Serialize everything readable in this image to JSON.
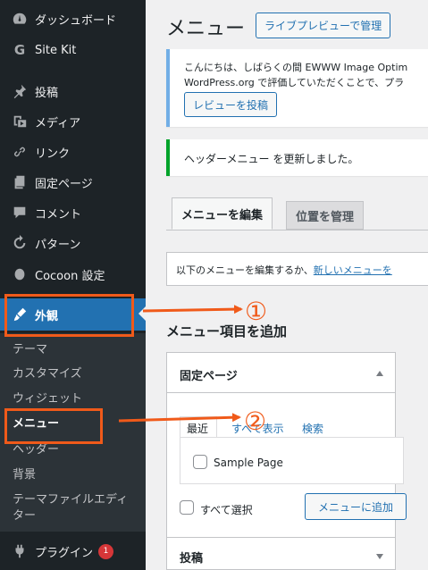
{
  "sidebar": {
    "items": [
      {
        "label": "ダッシュボード",
        "icon": "dashboard-icon"
      },
      {
        "label": "Site Kit",
        "icon": "google-g-icon"
      },
      {
        "label": "投稿",
        "icon": "pin-icon"
      },
      {
        "label": "メディア",
        "icon": "media-icon"
      },
      {
        "label": "リンク",
        "icon": "link-icon"
      },
      {
        "label": "固定ページ",
        "icon": "pages-icon"
      },
      {
        "label": "コメント",
        "icon": "comment-icon"
      },
      {
        "label": "パターン",
        "icon": "refresh-icon"
      },
      {
        "label": "Cocoon 設定",
        "icon": "circle-icon"
      },
      {
        "label": "外観",
        "icon": "brush-icon"
      }
    ],
    "submenu": [
      "テーマ",
      "カスタマイズ",
      "ウィジェット",
      "メニュー",
      "ヘッダー",
      "背景",
      "テーマファイルエディ",
      "ター"
    ],
    "plugins": {
      "label": "プラグイン",
      "badge": "1",
      "icon": "plugin-icon"
    }
  },
  "header": {
    "title": "メニュー",
    "live_preview_button": "ライブプレビューで管理"
  },
  "notices": {
    "info_line1": "こんにちは、しばらくの間 EWWW Image Optim",
    "info_line2": "WordPress.org で評価していただくことで、プラ",
    "review_button": "レビューを投稿",
    "success": "ヘッダーメニュー を更新しました。"
  },
  "tabs": {
    "edit": "メニューを編集",
    "locations": "位置を管理"
  },
  "manage_bar": {
    "text": "以下のメニューを編集するか、",
    "link": "新しいメニューを"
  },
  "add_items": {
    "title": "メニュー項目を追加",
    "pages_panel": "固定ページ",
    "inner_tabs": [
      "最近",
      "すべて表示",
      "検索"
    ],
    "item": "Sample Page",
    "select_all": "すべて選択",
    "add_button": "メニューに追加",
    "posts_panel": "投稿"
  },
  "annotations": {
    "mark1": "①",
    "mark2": "②",
    "color": "#f05a1a"
  },
  "colors": {
    "sidebar_bg": "#1d2327",
    "active": "#2271b1",
    "accent": "#f05a1a"
  }
}
